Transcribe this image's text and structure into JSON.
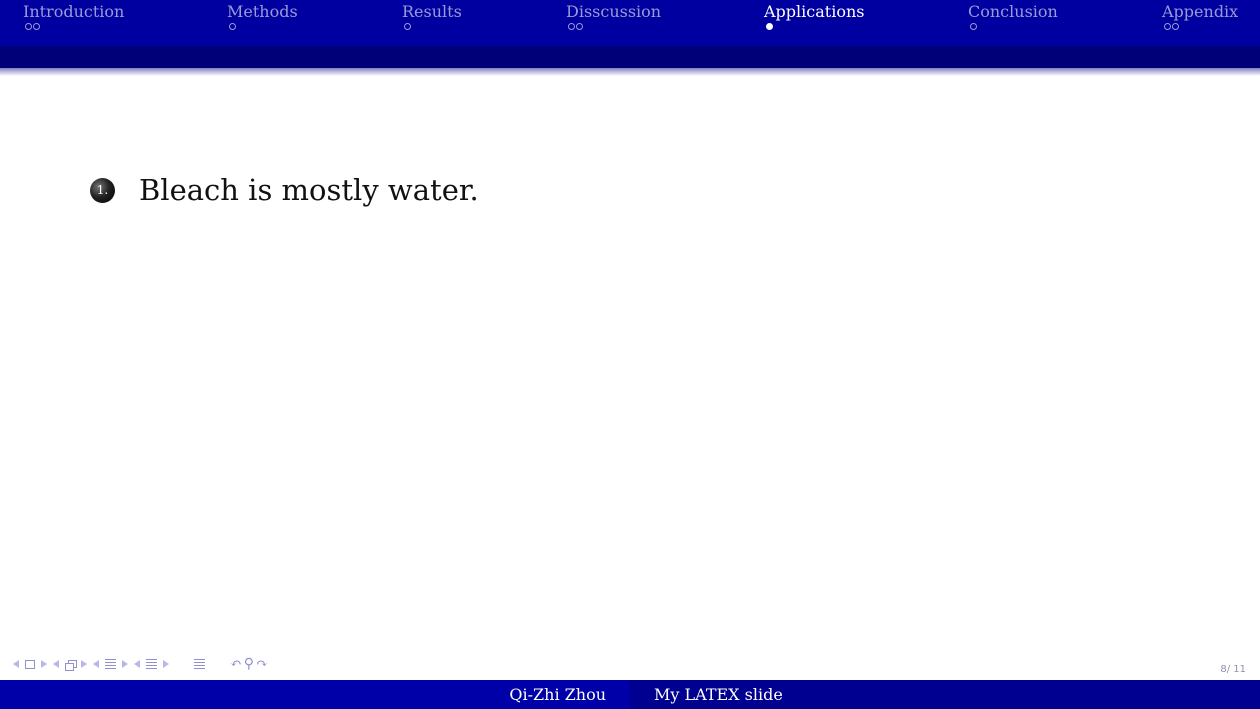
{
  "nav": {
    "sections": [
      {
        "label": "Introduction",
        "dots": [
          false,
          false
        ],
        "active": false
      },
      {
        "label": "Methods",
        "dots": [
          false
        ],
        "active": false
      },
      {
        "label": "Results",
        "dots": [
          false
        ],
        "active": false
      },
      {
        "label": "Disscussion",
        "dots": [
          false,
          false
        ],
        "active": false
      },
      {
        "label": "Applications",
        "dots": [
          true
        ],
        "active": true
      },
      {
        "label": "Conclusion",
        "dots": [
          false
        ],
        "active": false
      },
      {
        "label": "Appendix",
        "dots": [
          false,
          false
        ],
        "active": false
      }
    ]
  },
  "content": {
    "item_number": "1.",
    "item_text": "Bleach is mostly water."
  },
  "page": {
    "number": "8/ 11"
  },
  "footer": {
    "author": "Qi-Zhi Zhou",
    "title": "My LATEX slide"
  },
  "colors": {
    "nav_bar": "#0000a0",
    "nav_shade": "#000078",
    "footer_left": "#0000a8",
    "footer_right": "#000090",
    "inactive_text": "#9a9ad8",
    "active_text": "#ffffff"
  }
}
